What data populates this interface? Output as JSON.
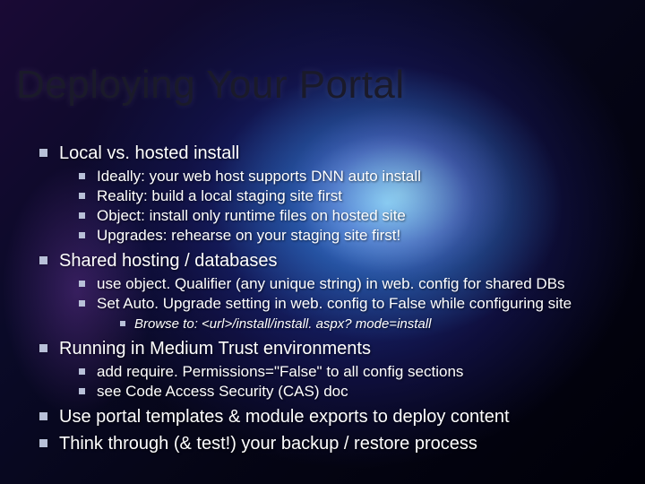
{
  "title": "Deploying Your Portal",
  "bullets": {
    "b1": "Local vs. hosted install",
    "b1_1": "Ideally: your web host supports DNN auto install",
    "b1_2": "Reality: build a local staging site first",
    "b1_3": "Object: install only runtime files on hosted site",
    "b1_4": "Upgrades: rehearse on your staging site first!",
    "b2": "Shared hosting / databases",
    "b2_1": "use object. Qualifier (any unique string) in web. config for shared DBs",
    "b2_2": "Set Auto. Upgrade setting in web. config to False while configuring site",
    "b2_2_1": "Browse to: <url>/install/install. aspx? mode=install",
    "b3": "Running in Medium Trust environments",
    "b3_1": "add require. Permissions=\"False\" to all config sections",
    "b3_2": "see Code Access Security (CAS) doc",
    "b4": "Use portal templates & module exports to deploy content",
    "b5": "Think through (& test!) your backup / restore process"
  }
}
